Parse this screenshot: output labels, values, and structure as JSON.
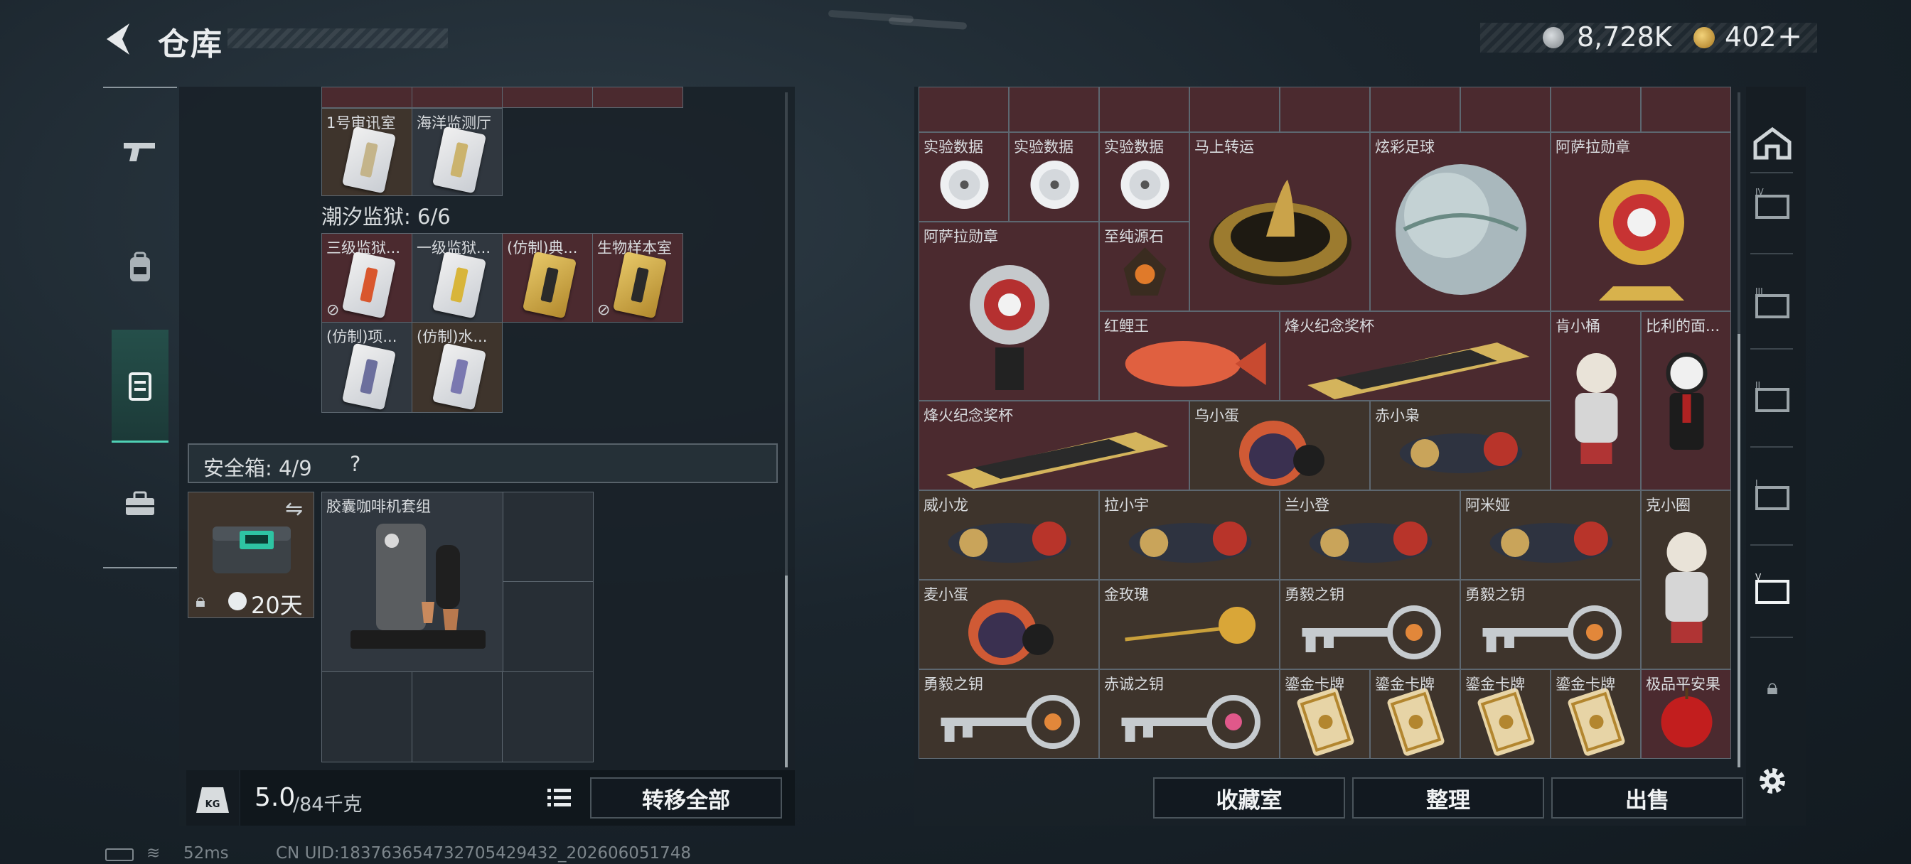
{
  "header": {
    "title": "仓库",
    "back_icon": "back-arrow-icon"
  },
  "currency": [
    {
      "icon": "silver-coin-icon",
      "value": "8,728K"
    },
    {
      "icon": "gold-coin-icon",
      "value": "402",
      "add": "+"
    }
  ],
  "left_tabs": [
    {
      "icon": "gun-icon",
      "active": false
    },
    {
      "icon": "backpack-icon",
      "active": false
    },
    {
      "icon": "container-icon",
      "active": true
    },
    {
      "icon": "toolbox-icon",
      "active": false
    }
  ],
  "stash": {
    "cards_top": [
      {
        "label": "1号审讯室",
        "bg": "brown",
        "accent": "#c4b48a"
      },
      {
        "label": "海洋监测厅",
        "bg": "grey",
        "accent": "#cbb36d"
      }
    ],
    "section_title": "潮汐监狱: 6/6",
    "cards": [
      {
        "label": "三级监狱...",
        "bg": "red",
        "accent": "#d9572d",
        "no_trade": true
      },
      {
        "label": "一级监狱...",
        "bg": "grey",
        "accent": "#d8b53a",
        "no_trade": false
      },
      {
        "label": "(仿制)典...",
        "bg": "red",
        "accent": "#2a2a2a",
        "no_trade": false
      },
      {
        "label": "生物样本室",
        "bg": "red",
        "accent": "#2a2a2a",
        "no_trade": true
      },
      {
        "label": "(仿制)项...",
        "bg": "grey",
        "accent": "#6c6f9d",
        "no_trade": false
      },
      {
        "label": "(仿制)水...",
        "bg": "brown",
        "accent": "#7a78b0",
        "no_trade": false
      }
    ],
    "safe_box_label": "安全箱: 4/9",
    "safe_box_help": "?",
    "safe_box_days": "20天",
    "coffee_label": "胶囊咖啡机套组",
    "weight_value": "5.0",
    "weight_max": "/84千克",
    "transfer_all": "转移全部"
  },
  "collection": {
    "items": [
      {
        "label": "实验数据",
        "kind": "disc"
      },
      {
        "label": "实验数据",
        "kind": "disc"
      },
      {
        "label": "实验数据",
        "kind": "disc"
      },
      {
        "label": "马上转运",
        "kind": "coin-statue"
      },
      {
        "label": "炫彩足球",
        "kind": "ball"
      },
      {
        "label": "阿萨拉勋章",
        "kind": "medal-gold"
      },
      {
        "label": "阿萨拉勋章",
        "kind": "medal-silver"
      },
      {
        "label": "至纯源石",
        "kind": "gem"
      },
      {
        "label": "红鲤王",
        "kind": "fish"
      },
      {
        "label": "烽火纪念奖杯",
        "kind": "trophy"
      },
      {
        "label": "肯小桶",
        "kind": "figure"
      },
      {
        "label": "比利的面...",
        "kind": "puppet"
      },
      {
        "label": "烽火纪念奖杯",
        "kind": "trophy"
      },
      {
        "label": "乌小蛋",
        "kind": "egg"
      },
      {
        "label": "赤小枭",
        "kind": "figure-lying"
      },
      {
        "label": "威小龙",
        "kind": "figure-lying"
      },
      {
        "label": "拉小宇",
        "kind": "figure-lying"
      },
      {
        "label": "兰小登",
        "kind": "figure-lying"
      },
      {
        "label": "阿米娅",
        "kind": "figure-lying"
      },
      {
        "label": "克小圈",
        "kind": "figure"
      },
      {
        "label": "麦小蛋",
        "kind": "egg"
      },
      {
        "label": "金玫瑰",
        "kind": "rose"
      },
      {
        "label": "勇毅之钥",
        "kind": "key"
      },
      {
        "label": "勇毅之钥",
        "kind": "key"
      },
      {
        "label": "勇毅之钥",
        "kind": "key"
      },
      {
        "label": "赤诚之钥",
        "kind": "key-pink"
      },
      {
        "label": "鎏金卡牌",
        "kind": "card"
      },
      {
        "label": "鎏金卡牌",
        "kind": "card"
      },
      {
        "label": "鎏金卡牌",
        "kind": "card"
      },
      {
        "label": "鎏金卡牌",
        "kind": "card"
      },
      {
        "label": "极品平安果",
        "kind": "apple"
      }
    ],
    "btn_collection": "收藏室",
    "btn_sort": "整理",
    "btn_sell": "出售"
  },
  "right_tabs": [
    "building-icon",
    "storage-iv-icon",
    "storage-iii-icon",
    "storage-ii-icon",
    "storage-i-icon",
    "storage-v-icon",
    "lock-icon"
  ],
  "settings_icon": "gear-icon",
  "status": {
    "ping": "52ms",
    "uid": "CN UID:183763654732705429432_202606051748"
  }
}
